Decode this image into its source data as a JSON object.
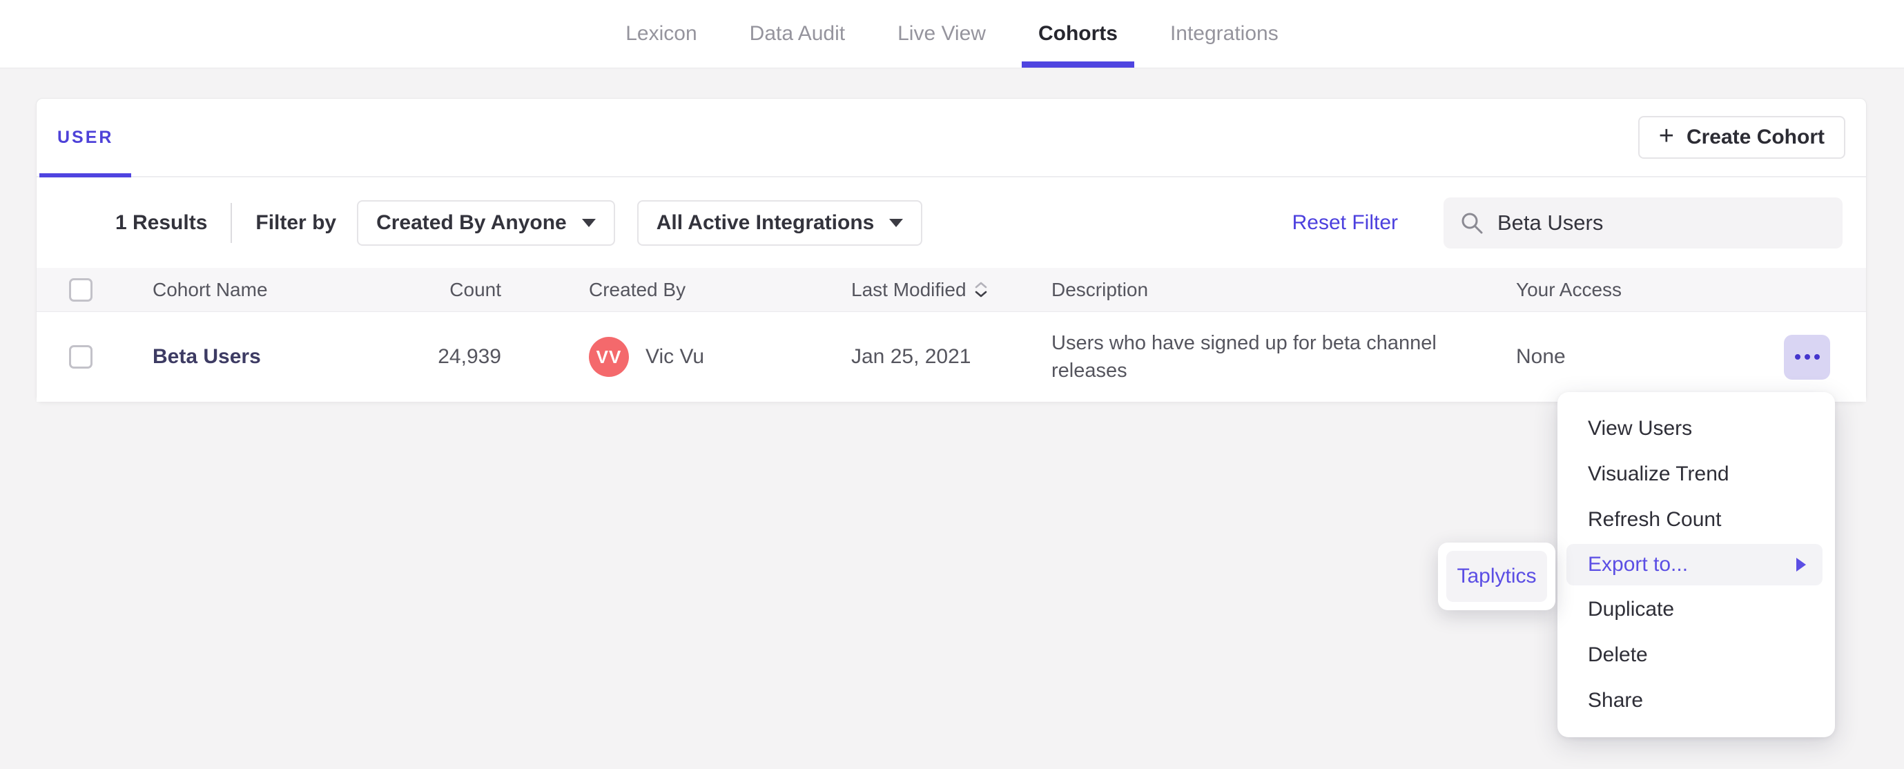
{
  "nav": {
    "items": [
      {
        "label": "Lexicon",
        "active": false
      },
      {
        "label": "Data Audit",
        "active": false
      },
      {
        "label": "Live View",
        "active": false
      },
      {
        "label": "Cohorts",
        "active": true
      },
      {
        "label": "Integrations",
        "active": false
      }
    ]
  },
  "panel": {
    "tab_label": "USER",
    "create_button": {
      "label": "Create Cohort",
      "icon": "plus-icon",
      "plus_glyph": "+"
    },
    "filters": {
      "results_text": "1 Results",
      "filter_by_label": "Filter by",
      "created_by_dropdown": "Created By Anyone",
      "integrations_dropdown": "All Active Integrations",
      "reset_label": "Reset Filter",
      "search": {
        "icon": "search-icon",
        "value": "Beta Users"
      }
    },
    "table": {
      "columns": {
        "name": "Cohort Name",
        "count": "Count",
        "created_by": "Created By",
        "last_modified": "Last Modified",
        "description": "Description",
        "access": "Your Access"
      },
      "sorted_column": "Last Modified",
      "rows": [
        {
          "name": "Beta Users",
          "count": "24,939",
          "creator_initials": "VV",
          "creator_name": "Vic Vu",
          "last_modified": "Jan 25, 2021",
          "description": "Users who have signed up for beta channel releases",
          "access": "None"
        }
      ]
    }
  },
  "context_menu": {
    "items": [
      {
        "label": "View Users"
      },
      {
        "label": "Visualize Trend"
      },
      {
        "label": "Refresh Count"
      },
      {
        "label": "Export to...",
        "highlighted": true,
        "has_submenu": true
      },
      {
        "label": "Duplicate"
      },
      {
        "label": "Delete"
      },
      {
        "label": "Share"
      }
    ],
    "submenu_items": [
      {
        "label": "Taplytics"
      }
    ]
  },
  "colors": {
    "accent": "#4f44e0",
    "menu_highlight_text": "#5b4ee4",
    "avatar": "#f4696c",
    "more_button_bg": "#d9d5f3",
    "cohort_name_text": "#3d3b63",
    "reset_filter_text": "#4c40de"
  }
}
